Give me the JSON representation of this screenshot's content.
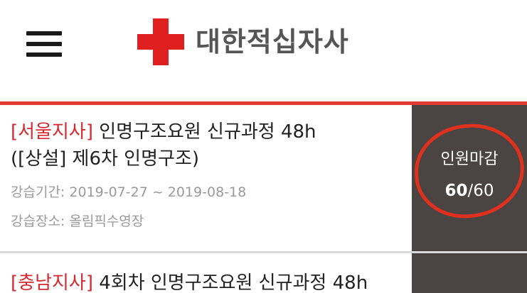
{
  "header": {
    "logo_text": "대한적십자사"
  },
  "courses": [
    {
      "branch": "[서울지사]",
      "title_line1": " 인명구조요원 신규과정 48h",
      "title_line2": "([상설] 제6차 인명구조)",
      "period_label": "강습기간: ",
      "period": "2019-07-27 ~ 2019-08-18",
      "place_label": "강습장소: ",
      "place": "올림픽수영장",
      "status": "인원마감",
      "enrolled": "60",
      "capacity": "/60"
    },
    {
      "branch": "[충남지사]",
      "title_line1": " 4회차 인명구조요원 신규과정 48h"
    }
  ],
  "colors": {
    "accent_red": "#e53a33",
    "branch_red": "#d7282f",
    "status_panel": "#4a4442"
  }
}
